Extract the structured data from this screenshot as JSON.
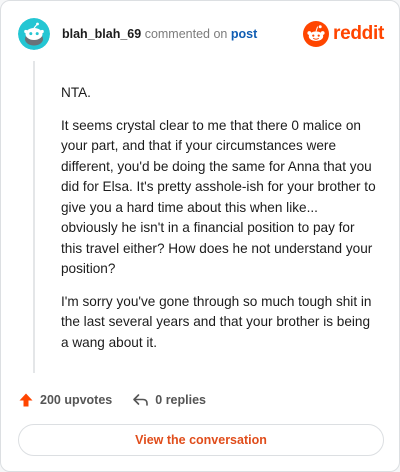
{
  "header": {
    "username": "blah_blah_69",
    "action_text": "commented on",
    "post_link": "post",
    "brand_name": "reddit",
    "brand_color": "#ff4500",
    "avatar_color": "#24c6d3"
  },
  "comment": {
    "paragraphs": [
      "NTA.",
      "It seems crystal clear to me that there 0 malice on your part, and that if your circumstances were different, you'd be doing the same for Anna that you did for Elsa. It's pretty asshole-ish for your brother to give you a hard time about this when like... obviously he isn't in a financial position to pay for this travel either? How does he not understand your position?",
      "I'm sorry you've gone through so much tough shit in the last several years and that your brother is being a wang about it."
    ]
  },
  "actions": {
    "upvotes": "200 upvotes",
    "upvote_icon": "arrow-up-icon",
    "replies": "0 replies",
    "reply_icon": "reply-arrow-icon"
  },
  "cta": {
    "label": "View the conversation"
  }
}
